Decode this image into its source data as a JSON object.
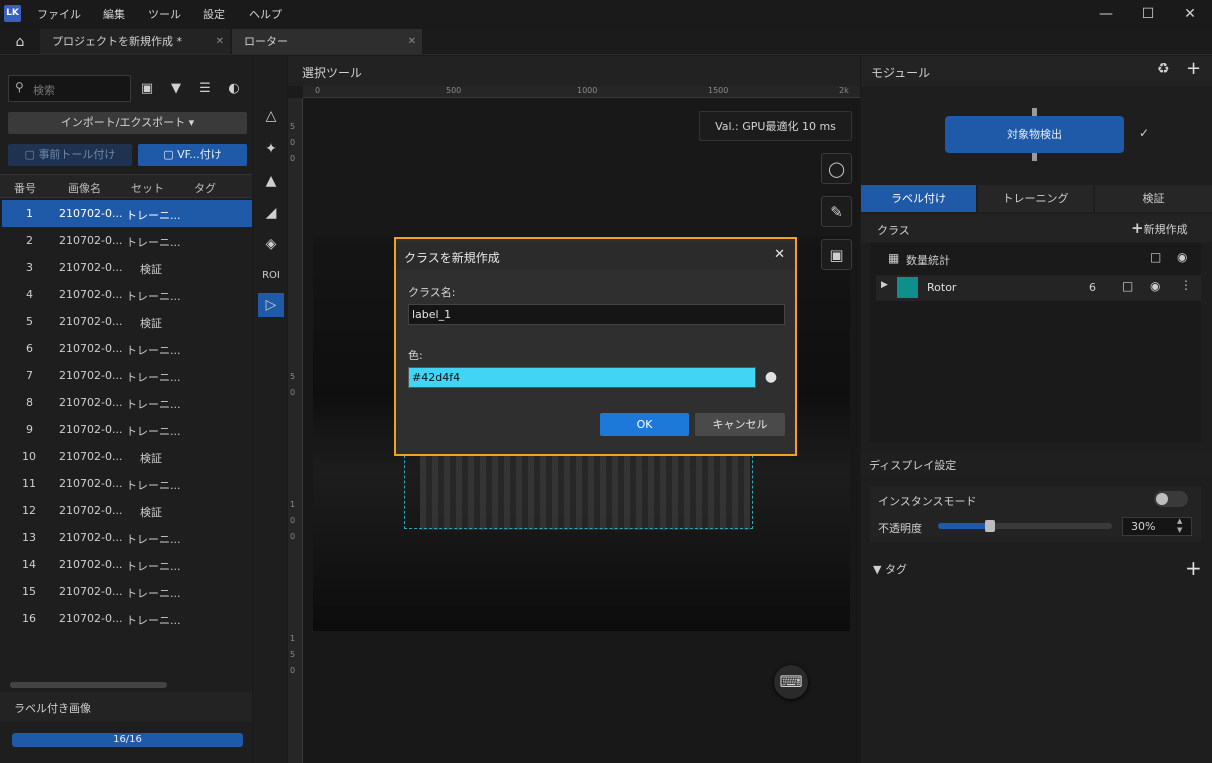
{
  "app": {
    "logo": "LK"
  },
  "menu": [
    "ファイル",
    "編集",
    "ツール",
    "設定",
    "ヘルプ"
  ],
  "tabs": [
    {
      "label": "プロジェクトを新規作成 *"
    },
    {
      "label": "ローター"
    }
  ],
  "left": {
    "search_placeholder": "検索",
    "import_label": "インポート/エクスポート ▾",
    "pretool_label": "事前トール付け",
    "vf_label": "VF...付け",
    "columns": [
      "番号",
      "画像名",
      "セット",
      "タグ"
    ],
    "rows": [
      {
        "num": "1",
        "name": "210702-0...",
        "set": "トレーニ..."
      },
      {
        "num": "2",
        "name": "210702-0...",
        "set": "トレーニ..."
      },
      {
        "num": "3",
        "name": "210702-0...",
        "set": "検証"
      },
      {
        "num": "4",
        "name": "210702-0...",
        "set": "トレーニ..."
      },
      {
        "num": "5",
        "name": "210702-0...",
        "set": "検証"
      },
      {
        "num": "6",
        "name": "210702-0...",
        "set": "トレーニ..."
      },
      {
        "num": "7",
        "name": "210702-0...",
        "set": "トレーニ..."
      },
      {
        "num": "8",
        "name": "210702-0...",
        "set": "トレーニ..."
      },
      {
        "num": "9",
        "name": "210702-0...",
        "set": "トレーニ..."
      },
      {
        "num": "10",
        "name": "210702-0...",
        "set": "検証"
      },
      {
        "num": "11",
        "name": "210702-0...",
        "set": "トレーニ..."
      },
      {
        "num": "12",
        "name": "210702-0...",
        "set": "検証"
      },
      {
        "num": "13",
        "name": "210702-0...",
        "set": "トレーニ..."
      },
      {
        "num": "14",
        "name": "210702-0...",
        "set": "トレーニ..."
      },
      {
        "num": "15",
        "name": "210702-0...",
        "set": "トレーニ..."
      },
      {
        "num": "16",
        "name": "210702-0...",
        "set": "トレーニ..."
      }
    ],
    "labeled_section": "ラベル付き画像",
    "progress_text": "16/16",
    "progress": 1.0
  },
  "canvas": {
    "title": "選択ツール",
    "ruler_h": [
      "0",
      "500",
      "1000",
      "1500",
      "2k"
    ],
    "ruler_v": [
      "5",
      "0",
      "0",
      "5",
      "0",
      "1",
      "0",
      "0",
      "1",
      "5",
      "0"
    ],
    "roi_label": "ROI",
    "val_badge": "Val.: GPU最適化 10 ms"
  },
  "right": {
    "module_title": "モジュール",
    "node_label": "対象物検出",
    "tabs": [
      "ラベル付け",
      "トレーニング",
      "検証"
    ],
    "class_title": "クラス",
    "new_class": "新規作成",
    "stats_label": "数量統計",
    "class_name": "Rotor",
    "class_count": "6",
    "class_color": "#0f8f8c",
    "display_title": "ディスプレイ設定",
    "instance_mode": "インスタンスモード",
    "opacity_label": "不透明度",
    "opacity_value": "30%",
    "opacity": 0.3,
    "tag_title": "タグ"
  },
  "dialog": {
    "title": "クラスを新規作成",
    "name_label": "クラス名:",
    "name_value": "label_1",
    "color_label": "色:",
    "color_value": "#42d4f4",
    "ok": "OK",
    "cancel": "キャンセル"
  },
  "colors": {
    "accent": "#1f5aa8",
    "dialog_border": "#f3a024",
    "picked_color": "#42d4f4"
  }
}
